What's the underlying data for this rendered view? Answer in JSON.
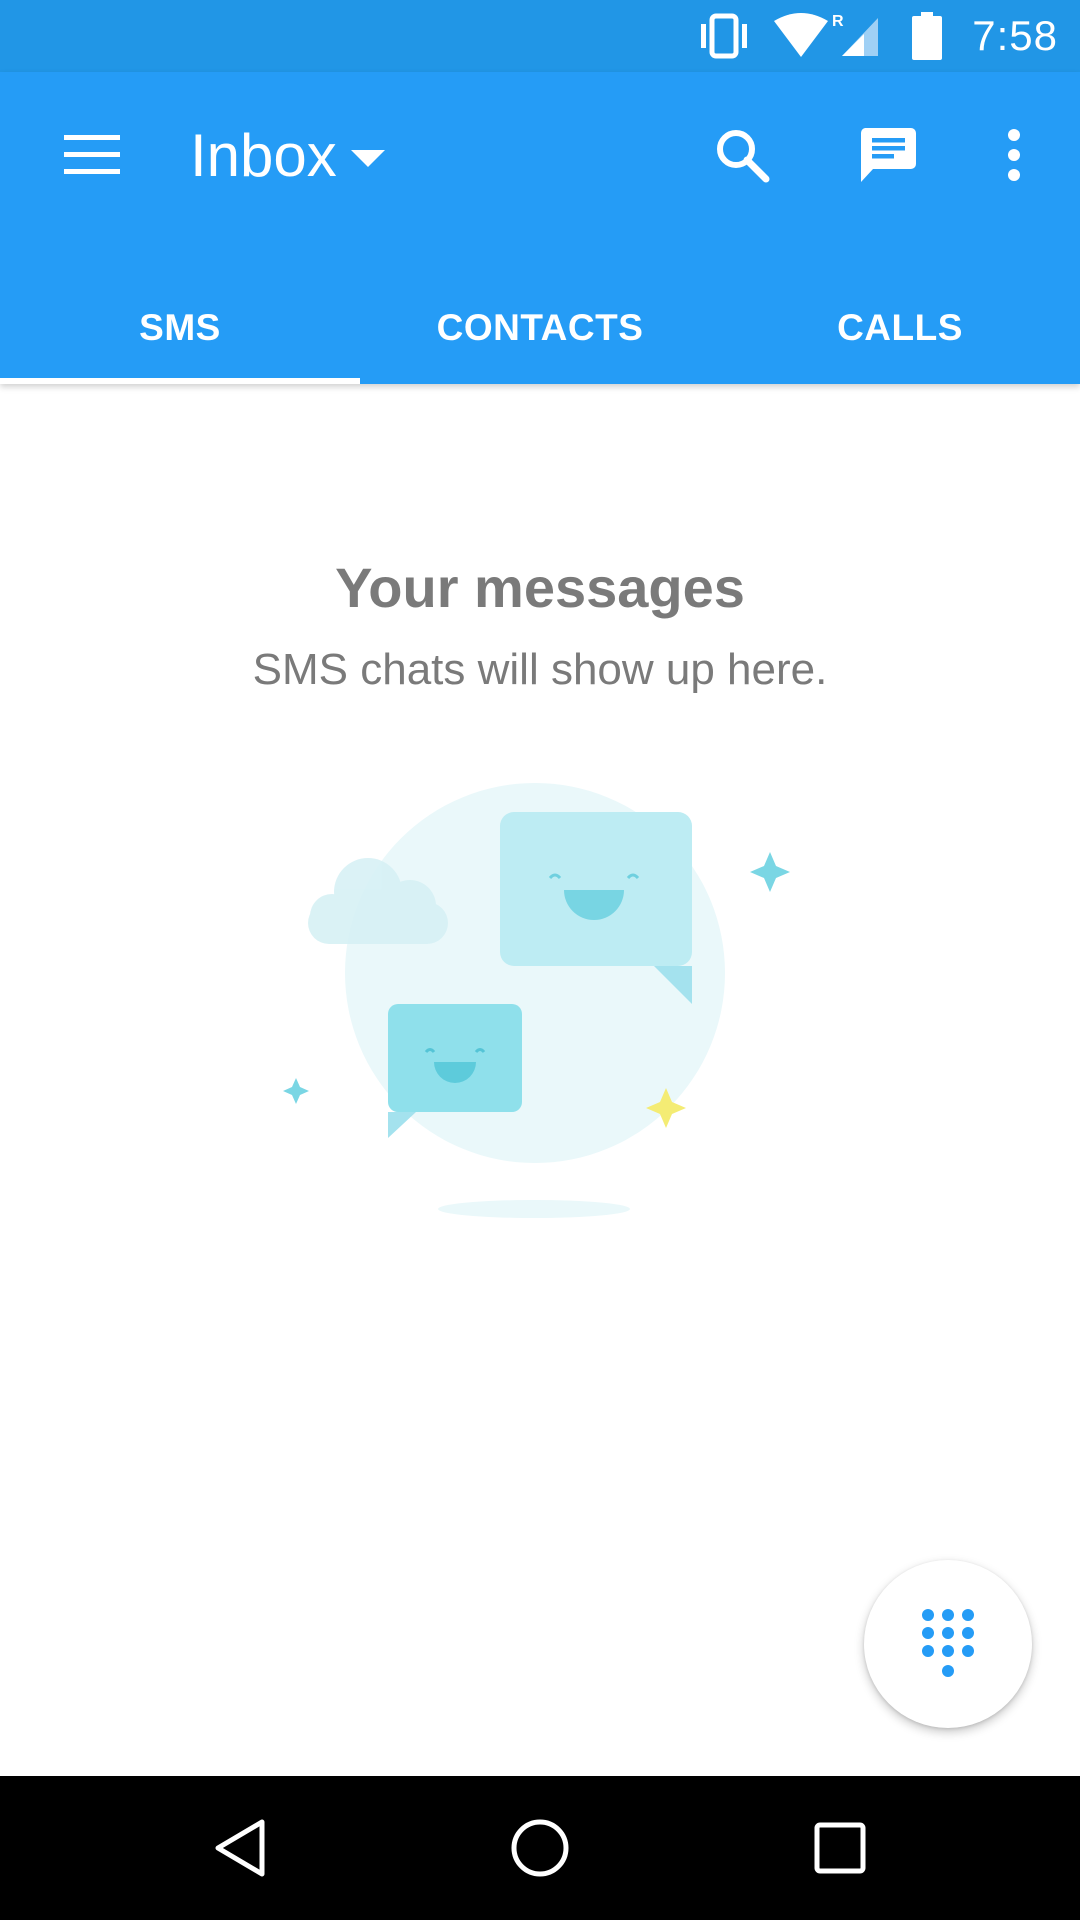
{
  "status_bar": {
    "time": "7:58",
    "icons": [
      "vibrate-icon",
      "wifi-icon",
      "cell-signal-roaming-icon",
      "battery-icon"
    ],
    "roaming_label": "R"
  },
  "app_bar": {
    "title": "Inbox",
    "menu_icon": "hamburger-menu-icon",
    "dropdown_icon": "caret-down-icon",
    "actions": [
      "search-icon",
      "chat-message-icon",
      "overflow-menu-icon"
    ]
  },
  "tabs": [
    {
      "label": "SMS",
      "selected": true
    },
    {
      "label": "CONTACTS",
      "selected": false
    },
    {
      "label": "CALLS",
      "selected": false
    }
  ],
  "empty_state": {
    "title": "Your messages",
    "subtitle": "SMS chats will show up here."
  },
  "fab": {
    "icon": "dialpad-icon"
  },
  "nav_bar": {
    "buttons": [
      "back-icon",
      "home-icon",
      "recents-icon"
    ]
  },
  "colors": {
    "status_bar": "#2196e6",
    "app_bar": "#259cf6",
    "accent": "#259cf6",
    "text_secondary": "#7a7a7a",
    "illustration_light": "#eaf8fa",
    "illustration_bubble": "#bdecf3",
    "illustration_star_yellow": "#f4ec74"
  }
}
